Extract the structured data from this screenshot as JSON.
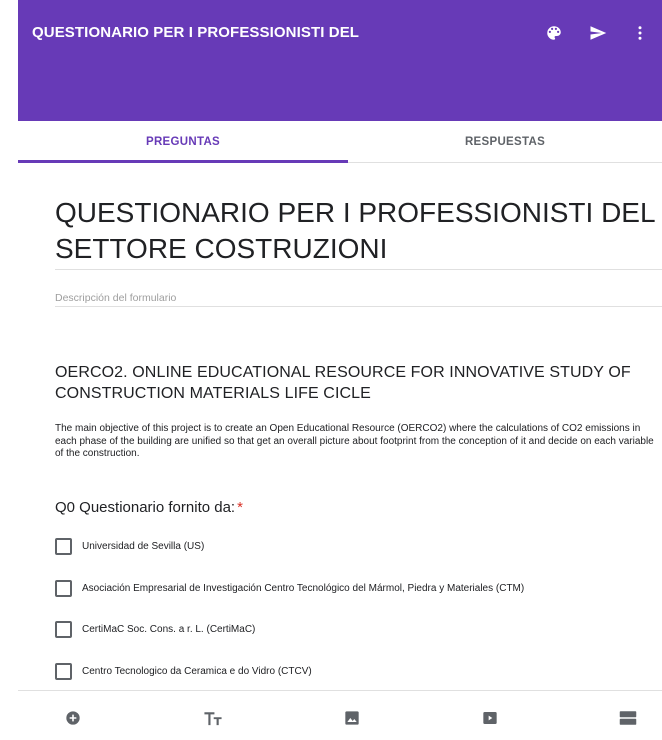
{
  "header": {
    "title": "QUESTIONARIO PER I PROFESSIONISTI DEL",
    "accent_color": "#673ab7",
    "icons": [
      "palette-icon",
      "send-icon",
      "more-vert-icon"
    ]
  },
  "tabs": [
    {
      "label": "PREGUNTAS",
      "active": true
    },
    {
      "label": "RESPUESTAS",
      "active": false
    }
  ],
  "form": {
    "title": "QUESTIONARIO PER I PROFESSIONISTI DEL SETTORE COSTRUZIONI",
    "description_placeholder": "Descripción del formulario"
  },
  "section": {
    "title": "OERCO2. ONLINE EDUCATIONAL RESOURCE FOR INNOVATIVE STUDY OF CONSTRUCTION MATERIALS LIFE CICLE",
    "body": "The main objective of this project is to create an Open Educational Resource (OERCO2) where the calculations of CO2 emissions in each phase of the building are unified so that get an overall picture about footprint from the conception of it and decide on each variable of the construction."
  },
  "question": {
    "title": "Q0 Questionario fornito da:",
    "required_mark": "*",
    "options": [
      "Universidad de Sevilla (US)",
      "Asociación Empresarial de Investigación Centro Tecnológico del Mármol, Piedra y Materiales (CTM)",
      "CertiMaC Soc. Cons. a r. L. (CertiMaC)",
      "Centro Tecnologico da Ceramica e do Vidro (CTCV)"
    ]
  },
  "toolbar": {
    "icons": [
      "add-question-icon",
      "add-title-icon",
      "add-image-icon",
      "add-video-icon",
      "add-section-icon"
    ]
  }
}
